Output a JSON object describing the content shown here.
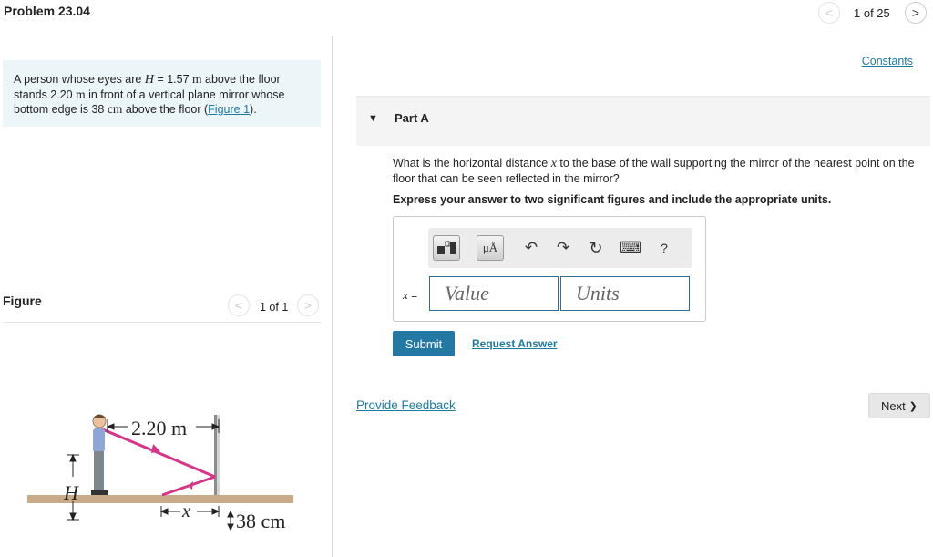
{
  "header": {
    "title": "Problem 23.04",
    "page_count": "1 of 25",
    "prev_glyph": "<",
    "next_glyph": ">"
  },
  "intro": {
    "t1": "A person whose eyes are ",
    "H": "H",
    "t2": " = 1.57 ",
    "m1": "m",
    "t3": " above the floor stands 2.20 ",
    "m2": "m",
    "t4": " in front of a vertical plane mirror whose bottom edge is 38 ",
    "cm": "cm",
    "t5": " above the floor (",
    "figure_link": "Figure 1",
    "t6": ")."
  },
  "figure": {
    "label": "Figure",
    "page_count": "1 of 1",
    "dist_label": "2.20 m",
    "H_label": "H",
    "mirror_height_label": "38 cm",
    "x_label": "x",
    "colors": {
      "ray": "#d4378a",
      "floor": "#c9ab8a",
      "shirt": "#8ea6d6",
      "pants": "#7f868e"
    }
  },
  "right": {
    "constants_link": "Constants",
    "part_toggle": "▼",
    "part_title": "Part A",
    "question_t1": "What is the horizontal distance ",
    "question_x": "x",
    "question_t2": " to the base of the wall supporting the mirror of the nearest point on the floor that can be seen reflected in the mirror?",
    "instruction": "Express your answer to two significant figures and include the appropriate units.",
    "toolbar": {
      "template_icon": "template-icon",
      "units_glyph": "μÅ",
      "undo_glyph": "↶",
      "redo_glyph": "↷",
      "reset_glyph": "↻",
      "keyboard_glyph": "⌨",
      "help_glyph": "?"
    },
    "answer_var": "x",
    "answer_eq": "=",
    "value_placeholder": "Value",
    "units_placeholder": "Units",
    "submit": "Submit",
    "request_answer": "Request Answer",
    "feedback": "Provide Feedback",
    "next": "Next",
    "next_glyph": "❯"
  },
  "accent_color": "#2479a4"
}
